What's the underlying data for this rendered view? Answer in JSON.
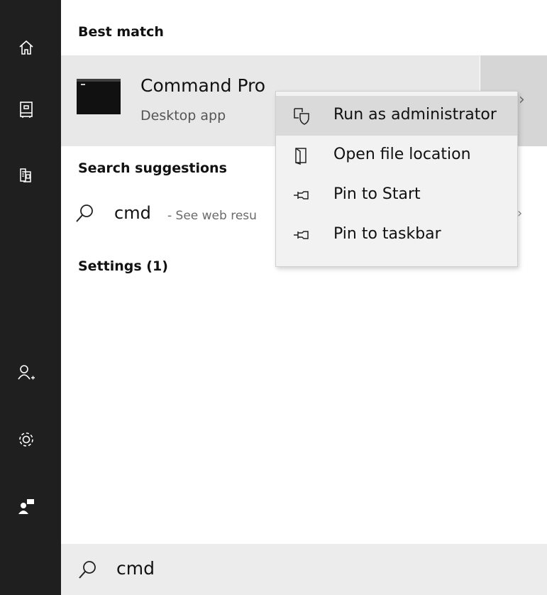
{
  "sidebar": {
    "icons": [
      "home-icon",
      "notebook-icon",
      "documents-icon",
      "add-account-icon",
      "settings-gear-icon",
      "feedback-icon"
    ]
  },
  "best_match": {
    "heading": "Best match",
    "app_name": "Command Pro",
    "app_type": "Desktop app"
  },
  "search_suggestions": {
    "heading": "Search suggestions",
    "query": "cmd",
    "secondary": "- See web resu"
  },
  "settings": {
    "heading": "Settings (1)"
  },
  "context_menu": {
    "items": [
      {
        "label": "Run as administrator",
        "icon": "shield-admin-icon"
      },
      {
        "label": "Open file location",
        "icon": "file-location-icon"
      },
      {
        "label": "Pin to Start",
        "icon": "pin-icon"
      },
      {
        "label": "Pin to taskbar",
        "icon": "pin-icon"
      }
    ]
  },
  "search_box": {
    "value": "cmd"
  },
  "colors": {
    "rail": "#1f1f1f",
    "accent": "#5fa8d9",
    "highlight": "#e8e8e8",
    "menu_bg": "#f2f2f2"
  }
}
